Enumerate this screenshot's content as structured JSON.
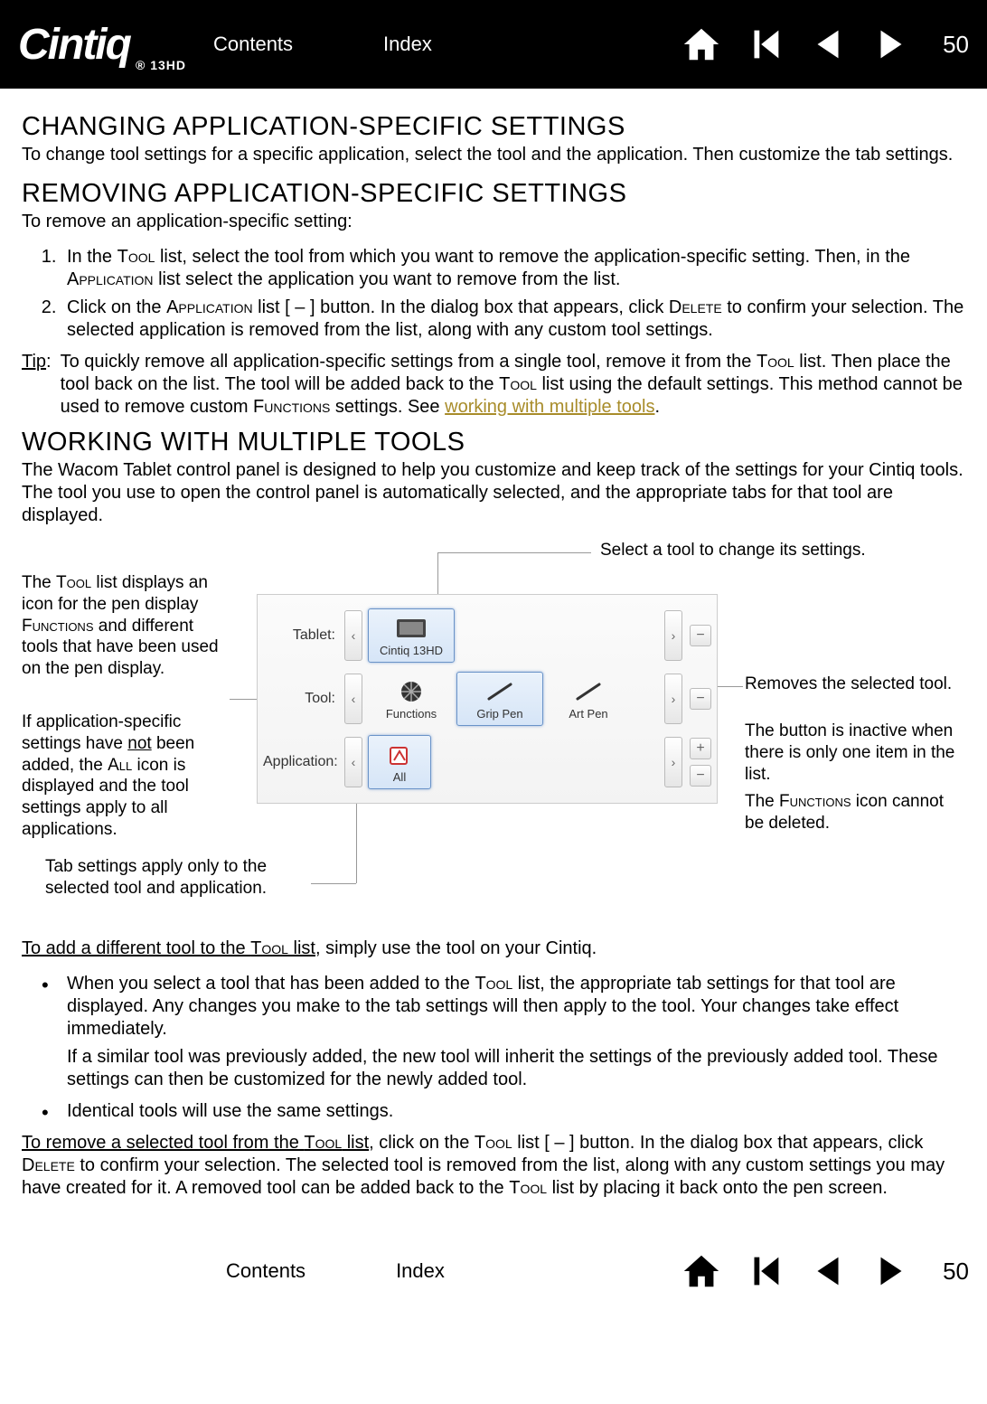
{
  "header": {
    "brand": "Cintiq",
    "brand_sub": "13HD",
    "contents": "Contents",
    "index": "Index",
    "page": "50"
  },
  "section1": {
    "title": "CHANGING APPLICATION-SPECIFIC SETTINGS",
    "body": "To change tool settings for a specific application, select the tool and the application. Then customize the tab settings."
  },
  "section2": {
    "title": "REMOVING APPLICATION-SPECIFIC SETTINGS",
    "intro": "To remove an application-specific setting:",
    "li1_a": "In the ",
    "li1_b": "Tool",
    "li1_c": " list, select the tool from which you want to remove the application-specific setting. Then, in the ",
    "li1_d": "Application",
    "li1_e": " list select the application you want to remove from the list.",
    "li2_a": "Click on the ",
    "li2_b": "Application",
    "li2_c": " list [ – ] button. In the dialog box that appears, click ",
    "li2_d": "Delete",
    "li2_e": " to confirm your selection. The selected application is removed from the list, along with any custom tool settings.",
    "tip_label": "Tip",
    "tip_a": "To quickly remove all application-specific settings from a single tool, remove it from the ",
    "tip_b": "Tool",
    "tip_c": " list. Then place the tool back on the list. The tool will be added back to the ",
    "tip_d": "Tool",
    "tip_e": " list using the default settings. This method cannot be used to remove custom ",
    "tip_f": "Functions",
    "tip_g": " settings. See ",
    "tip_link": "working with multiple tools",
    "tip_h": "."
  },
  "section3": {
    "title": "WORKING WITH MULTIPLE TOOLS",
    "body": "The Wacom Tablet control panel is designed to help you customize and keep track of the settings for your Cintiq tools. The tool you use to open the control panel is automatically selected, and the appropriate tabs for that tool are displayed."
  },
  "diagram": {
    "top_callout": "Select a tool to change its settings.",
    "left1_a": "The ",
    "left1_b": "Tool",
    "left1_c": " list displays an icon for the pen display ",
    "left1_d": "Functions",
    "left1_e": " and different tools that have been used on the pen display.",
    "left2_a": "If application-specific settings have ",
    "left2_b": "not",
    "left2_c": " been added, the ",
    "left2_d": "All",
    "left2_e": " icon is displayed and the tool settings apply to all applications.",
    "bottom_callout": "Tab settings apply only to the selected tool and application.",
    "right1": "Removes the selected tool.",
    "right2": "The button is inactive when there is only one item in the list.",
    "right3_a": "The ",
    "right3_b": "Functions",
    "right3_c": " icon cannot be deleted.",
    "panel": {
      "row1_label": "Tablet:",
      "row1_item": "Cintiq 13HD",
      "row2_label": "Tool:",
      "row2_items": [
        "Functions",
        "Grip Pen",
        "Art Pen"
      ],
      "row3_label": "Application:",
      "row3_item": "All"
    }
  },
  "section4": {
    "add_a": "To add a different tool to the ",
    "add_b": "Tool",
    "add_c": " list",
    "add_d": ", simply use the tool on your Cintiq.",
    "b1_a": "When you select a tool that has been added to the ",
    "b1_b": "Tool",
    "b1_c": " list, the appropriate tab settings for that tool are displayed. Any changes you make to the tab settings will then apply to the tool. Your changes take effect immediately.",
    "b1_sub": "If a similar tool was previously added, the new tool will inherit the settings of the previously added tool. These settings can then be customized for the newly added tool.",
    "b2": "Identical tools will use the same settings.",
    "rem_a": "To remove a selected tool from the ",
    "rem_b": "Tool",
    "rem_c": " list",
    "rem_d": ", click on the ",
    "rem_e": "Tool",
    "rem_f": " list [ – ] button. In the dialog box that appears, click ",
    "rem_g": "Delete",
    "rem_h": " to confirm your selection. The selected tool is removed from the list, along with any custom settings you may have created for it. A removed tool can be added back to the ",
    "rem_i": "Tool",
    "rem_j": " list by placing it back onto the pen screen."
  },
  "footer": {
    "contents": "Contents",
    "index": "Index",
    "page": "50"
  }
}
